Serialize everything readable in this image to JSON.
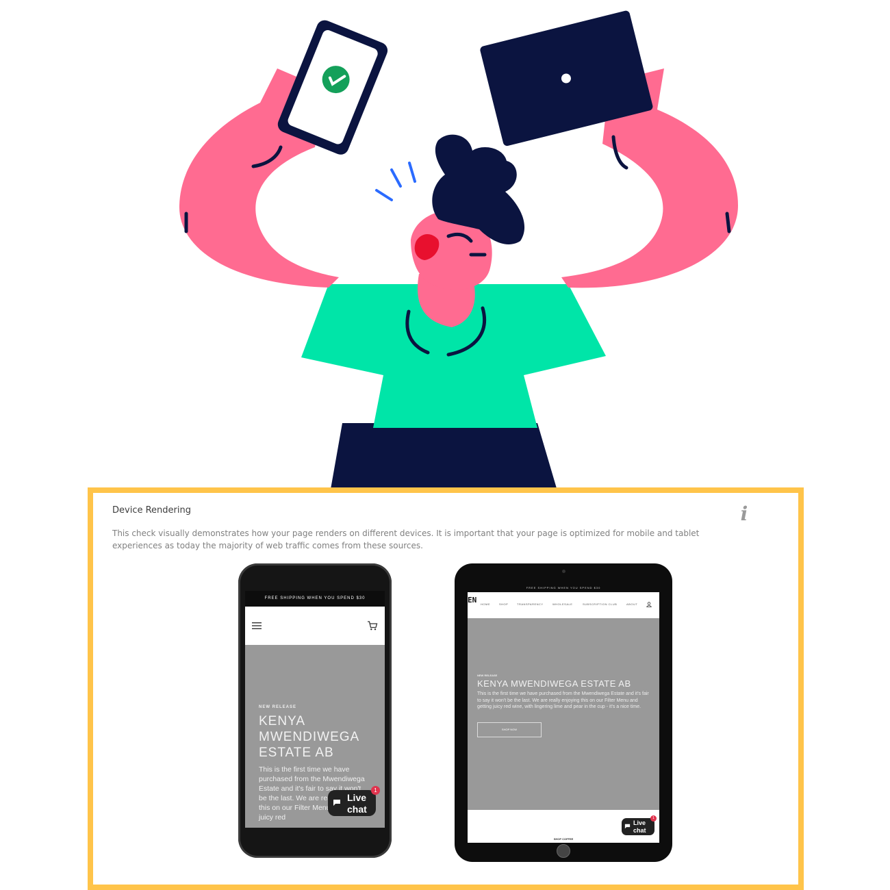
{
  "colors": {
    "card_border": "#ffc44a",
    "skin": "#ff6b91",
    "shirt": "#00e5a8",
    "navy": "#0b1440",
    "check_green": "#14a05a",
    "accent_blue": "#2b6bff"
  },
  "illustration": {
    "icons": [
      "phone-with-check-icon",
      "laptop-icon",
      "excited-person-figure"
    ]
  },
  "card": {
    "title": "Device Rendering",
    "info_icon": "i",
    "description": "This check visually demonstrates how your page renders on different devices. It is important that your page is optimized for mobile and tablet experiences as today the majority of web traffic comes from these sources."
  },
  "phone": {
    "banner": "FREE SHIPPING WHEN YOU SPEND $30",
    "hero_eyebrow": "NEW RELEASE",
    "hero_title": "KENYA MWENDIWEGA ESTATE AB",
    "hero_body": "This is the first time we have purchased from the Mwendiwega Estate and it's fair to say it won't be the last. We are really enjoying this on our Filter Menu and getting juicy red",
    "chat_label": "Live chat",
    "chat_badge": "1"
  },
  "tablet": {
    "banner": "FREE SHIPPING WHEN YOU SPEND $30",
    "logo": "EN",
    "nav": [
      "HOME",
      "SHOP",
      "TRANSPARENCY",
      "WHOLESALE",
      "SUBSCRIPTION CLUB",
      "ABOUT"
    ],
    "hero_eyebrow": "NEW RELEASE",
    "hero_title": "KENYA MWENDIWEGA ESTATE AB",
    "hero_body": "This is the first time we have purchased from the Mwendiwega Estate and it's fair to say it won't be the last. We are really enjoying this on our Filter Menu and getting juicy red wine, with lingering lime and pear in the cup - it's a nice time.",
    "hero_button": "SHOP NOW",
    "footer_link": "SHOP COFFEE",
    "chat_label": "Live chat",
    "chat_badge": "1"
  }
}
